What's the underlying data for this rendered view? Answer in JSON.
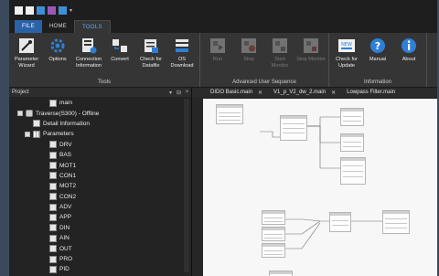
{
  "menu": {
    "tabs": [
      "FILE",
      "HOME",
      "TOOLS"
    ]
  },
  "ribbon": {
    "groups": [
      {
        "label": "Tools",
        "buttons": [
          {
            "label": "Parameter Wizard",
            "icon": "wizard-icon"
          },
          {
            "label": "Options",
            "icon": "gear-icon"
          },
          {
            "label": "Connection Information",
            "icon": "connection-info-icon"
          },
          {
            "label": "Convert",
            "icon": "convert-icon"
          },
          {
            "label": "Check for Datafile",
            "icon": "datafile-check-icon"
          },
          {
            "label": "OS Download",
            "icon": "os-download-icon"
          }
        ]
      },
      {
        "label": "Advanced User Sequence",
        "buttons": [
          {
            "label": "Run",
            "icon": "run-icon"
          },
          {
            "label": "Stop",
            "icon": "stop-icon"
          },
          {
            "label": "Start Monitor",
            "icon": "start-monitor-icon"
          },
          {
            "label": "Stop Monitor",
            "icon": "stop-monitor-icon"
          }
        ]
      },
      {
        "label": "Information",
        "buttons": [
          {
            "label": "Check for Update",
            "icon": "new-update-icon"
          },
          {
            "label": "Manual",
            "icon": "help-icon"
          },
          {
            "label": "About",
            "icon": "info-icon"
          }
        ]
      }
    ]
  },
  "project": {
    "title": "Project",
    "controls": [
      "▾",
      "⊟",
      "×"
    ],
    "tree": [
      {
        "label": "main",
        "level": 3,
        "icon": "function-block-icon"
      },
      {
        "label": "Traverse(S300) - Offline",
        "level": 1,
        "icon": "drive-icon",
        "expander": true
      },
      {
        "label": "Detail Information",
        "level": 2,
        "icon": "document-icon"
      },
      {
        "label": "Parameters",
        "level": 2,
        "icon": "parameters-icon",
        "expander": true
      },
      {
        "label": "DRV",
        "level": 3,
        "icon": "parameter-group-icon"
      },
      {
        "label": "BAS",
        "level": 3,
        "icon": "parameter-group-icon"
      },
      {
        "label": "MOT1",
        "level": 3,
        "icon": "parameter-group-icon"
      },
      {
        "label": "CON1",
        "level": 3,
        "icon": "parameter-group-icon"
      },
      {
        "label": "MOT2",
        "level": 3,
        "icon": "parameter-group-icon"
      },
      {
        "label": "CON2",
        "level": 3,
        "icon": "parameter-group-icon"
      },
      {
        "label": "ADV",
        "level": 3,
        "icon": "parameter-group-icon"
      },
      {
        "label": "APP",
        "level": 3,
        "icon": "parameter-group-icon"
      },
      {
        "label": "DIN",
        "level": 3,
        "icon": "parameter-group-icon"
      },
      {
        "label": "AIN",
        "level": 3,
        "icon": "parameter-group-icon"
      },
      {
        "label": "OUT",
        "level": 3,
        "icon": "parameter-group-icon"
      },
      {
        "label": "PRO",
        "level": 3,
        "icon": "parameter-group-icon"
      },
      {
        "label": "PID",
        "level": 3,
        "icon": "parameter-group-icon"
      }
    ]
  },
  "editor": {
    "tabs": [
      {
        "label": "DIDO Basic.main"
      },
      {
        "label": "V1_p_V2_dw_2.main"
      },
      {
        "label": "Lowpass Filter.main"
      }
    ]
  },
  "colors": {
    "accent": "#5ab0ff",
    "file_tab": "#2a62a8",
    "ribbon_bg": "#353535",
    "panel_bg": "#232323"
  }
}
